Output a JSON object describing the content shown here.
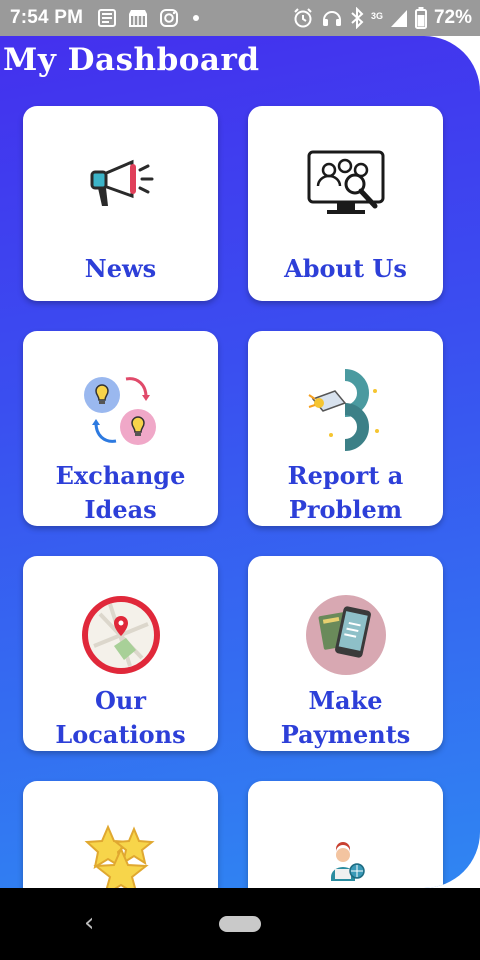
{
  "status_bar": {
    "time": "7:54 PM",
    "network": "3G",
    "battery": "72%",
    "icons_left": [
      "news-icon",
      "store-icon",
      "instagram-icon",
      "dot-icon"
    ],
    "icons_right": [
      "alarm-icon",
      "headset-icon",
      "bluetooth-icon",
      "signal-icon",
      "battery-icon"
    ]
  },
  "header": {
    "title": "My Dashboard"
  },
  "cards": [
    {
      "label_lines": [
        "News"
      ],
      "icon": "megaphone-icon"
    },
    {
      "label_lines": [
        "About Us"
      ],
      "icon": "team-search-icon"
    },
    {
      "label_lines": [
        "Exchange",
        "Ideas"
      ],
      "icon": "idea-exchange-icon"
    },
    {
      "label_lines": [
        "Report a",
        "Problem"
      ],
      "icon": "report-problem-icon"
    },
    {
      "label_lines": [
        "Our",
        "Locations"
      ],
      "icon": "map-pin-icon"
    },
    {
      "label_lines": [
        "Make",
        "Payments"
      ],
      "icon": "payment-phone-icon"
    },
    {
      "label_lines": [],
      "icon": "stars-icon"
    },
    {
      "label_lines": [],
      "icon": "support-agent-icon"
    }
  ],
  "colors": {
    "panel_top": "#4430ee",
    "panel_bottom": "#2f86f2",
    "card_label": "#2d3fd8",
    "status_bar": "#9a9a9a"
  },
  "nav": {
    "back_glyph": "‹"
  }
}
